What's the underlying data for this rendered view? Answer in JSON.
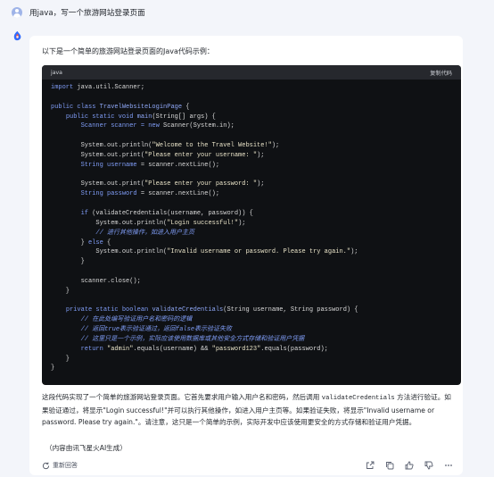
{
  "user": {
    "message": "用java，写一个旅游网站登录页面"
  },
  "answer": {
    "intro": "以下是一个简单的旅游网站登录页面的Java代码示例：",
    "code_block": {
      "language": "java",
      "copy_label": "复制代码",
      "lines": [
        [
          {
            "t": "kw",
            "v": "import"
          },
          {
            "t": "tx",
            "v": " java.util.Scanner;"
          }
        ],
        [],
        [
          {
            "t": "kw",
            "v": "public class"
          },
          {
            "t": "tx",
            "v": " "
          },
          {
            "t": "fn",
            "v": "TravelWebsiteLoginPage"
          },
          {
            "t": "tx",
            "v": " {"
          }
        ],
        [
          {
            "t": "tx",
            "v": "    "
          },
          {
            "t": "kw",
            "v": "public static void"
          },
          {
            "t": "tx",
            "v": " "
          },
          {
            "t": "fn",
            "v": "main"
          },
          {
            "t": "tx",
            "v": "(String[] args) {"
          }
        ],
        [
          {
            "t": "tx",
            "v": "        "
          },
          {
            "t": "kw",
            "v": "Scanner scanner = new"
          },
          {
            "t": "tx",
            "v": " Scanner(System.in);"
          }
        ],
        [],
        [
          {
            "t": "tx",
            "v": "        System.out.println("
          },
          {
            "t": "str",
            "v": "\"Welcome to the Travel Website!\""
          },
          {
            "t": "tx",
            "v": ");"
          }
        ],
        [
          {
            "t": "tx",
            "v": "        System.out.print("
          },
          {
            "t": "str",
            "v": "\"Please enter your username: \""
          },
          {
            "t": "tx",
            "v": ");"
          }
        ],
        [
          {
            "t": "tx",
            "v": "        "
          },
          {
            "t": "kw",
            "v": "String username"
          },
          {
            "t": "tx",
            "v": " = scanner.nextLine();"
          }
        ],
        [],
        [
          {
            "t": "tx",
            "v": "        System.out.print("
          },
          {
            "t": "str",
            "v": "\"Please enter your password: \""
          },
          {
            "t": "tx",
            "v": ");"
          }
        ],
        [
          {
            "t": "tx",
            "v": "        "
          },
          {
            "t": "kw",
            "v": "String password"
          },
          {
            "t": "tx",
            "v": " = scanner.nextLine();"
          }
        ],
        [],
        [
          {
            "t": "tx",
            "v": "        "
          },
          {
            "t": "kw",
            "v": "if"
          },
          {
            "t": "tx",
            "v": " (validateCredentials(username, password)) {"
          }
        ],
        [
          {
            "t": "tx",
            "v": "            System.out.println("
          },
          {
            "t": "str",
            "v": "\"Login successful!\""
          },
          {
            "t": "tx",
            "v": ");"
          }
        ],
        [
          {
            "t": "tx",
            "v": "            "
          },
          {
            "t": "com",
            "v": "// 进行其他操作，如进入用户主页"
          }
        ],
        [
          {
            "t": "tx",
            "v": "        } "
          },
          {
            "t": "kw",
            "v": "else"
          },
          {
            "t": "tx",
            "v": " {"
          }
        ],
        [
          {
            "t": "tx",
            "v": "            System.out.println("
          },
          {
            "t": "str",
            "v": "\"Invalid username or password. Please try again.\""
          },
          {
            "t": "tx",
            "v": ");"
          }
        ],
        [
          {
            "t": "tx",
            "v": "        }"
          }
        ],
        [],
        [
          {
            "t": "tx",
            "v": "        scanner.close();"
          }
        ],
        [
          {
            "t": "tx",
            "v": "    }"
          }
        ],
        [],
        [
          {
            "t": "tx",
            "v": "    "
          },
          {
            "t": "kw",
            "v": "private static boolean"
          },
          {
            "t": "tx",
            "v": " "
          },
          {
            "t": "fn",
            "v": "validateCredentials"
          },
          {
            "t": "tx",
            "v": "(String username, String password) {"
          }
        ],
        [
          {
            "t": "tx",
            "v": "        "
          },
          {
            "t": "com",
            "v": "// 在此处编写验证用户名和密码的逻辑"
          }
        ],
        [
          {
            "t": "tx",
            "v": "        "
          },
          {
            "t": "com",
            "v": "// 返回true表示验证通过，返回false表示验证失败"
          }
        ],
        [
          {
            "t": "tx",
            "v": "        "
          },
          {
            "t": "com",
            "v": "// 这里只是一个示例，实际应该使用数据库或其他安全方式存储和验证用户凭据"
          }
        ],
        [
          {
            "t": "tx",
            "v": "        "
          },
          {
            "t": "kw",
            "v": "return"
          },
          {
            "t": "tx",
            "v": " "
          },
          {
            "t": "str",
            "v": "\"admin\""
          },
          {
            "t": "tx",
            "v": ".equals(username) && "
          },
          {
            "t": "str",
            "v": "\"password123\""
          },
          {
            "t": "tx",
            "v": ".equals(password);"
          }
        ],
        [
          {
            "t": "tx",
            "v": "    }"
          }
        ],
        [
          {
            "t": "tx",
            "v": "}"
          }
        ]
      ]
    },
    "explanation": {
      "p1_before": "这段代码实现了一个简单的旅游网站登录页面。它首先要求用户输入用户名和密码，然后调用 ",
      "p1_code": "validateCredentials",
      "p1_after": " 方法进行验证。如果验证通过，将显示\"Login successful!\"并可以执行其他操作，如进入用户主页等。如果验证失败，将显示\"Invalid username or password. Please try again.\"。请注意，这只是一个简单的示例，实际开发中应该使用更安全的方式存储和验证用户凭据。"
    },
    "source_note": "（内容由讯飞星火AI生成）",
    "regenerate_label": "重新回答",
    "action_icons": [
      "share-icon",
      "copy-icon",
      "thumbs-up-icon",
      "thumbs-down-icon",
      "more-icon"
    ]
  },
  "colors": {
    "background": "#f3f5fa",
    "code_bg": "#0f1114",
    "code_header_bg": "#26282d",
    "keyword": "#7f9cf5",
    "string": "#e9e3c8"
  }
}
